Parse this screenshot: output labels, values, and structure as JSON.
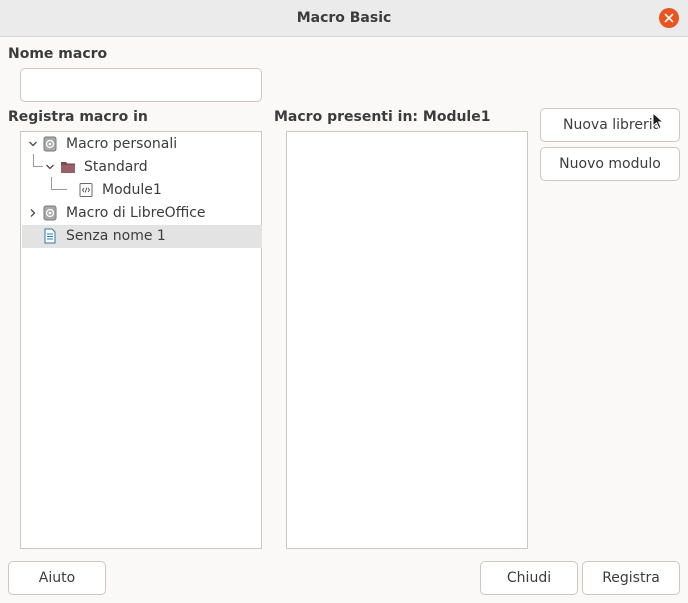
{
  "window": {
    "title": "Macro Basic",
    "close_icon": "close-icon",
    "accent_color": "#e95420"
  },
  "macro_name": {
    "label": "Nome macro",
    "value": "",
    "placeholder": ""
  },
  "record_in": {
    "label": "Registra macro in",
    "tree": [
      {
        "label": "Macro personali",
        "icon": "macro-container-icon",
        "expanded": true,
        "level": 0
      },
      {
        "label": "Standard",
        "icon": "library-folder-icon",
        "expanded": true,
        "level": 1
      },
      {
        "label": "Module1",
        "icon": "module-code-icon",
        "level": 2
      },
      {
        "label": "Macro di LibreOffice",
        "icon": "macro-container-icon",
        "expanded": false,
        "level": 0
      },
      {
        "label": "Senza nome 1",
        "icon": "document-icon",
        "selected": true,
        "level": 0
      }
    ]
  },
  "existing_macros": {
    "label": "Macro presenti in: Module1",
    "items": []
  },
  "buttons": {
    "new_library": "Nuova libreria",
    "new_module": "Nuovo modulo",
    "help": "Aiuto",
    "close": "Chiudi",
    "record": "Registra"
  }
}
